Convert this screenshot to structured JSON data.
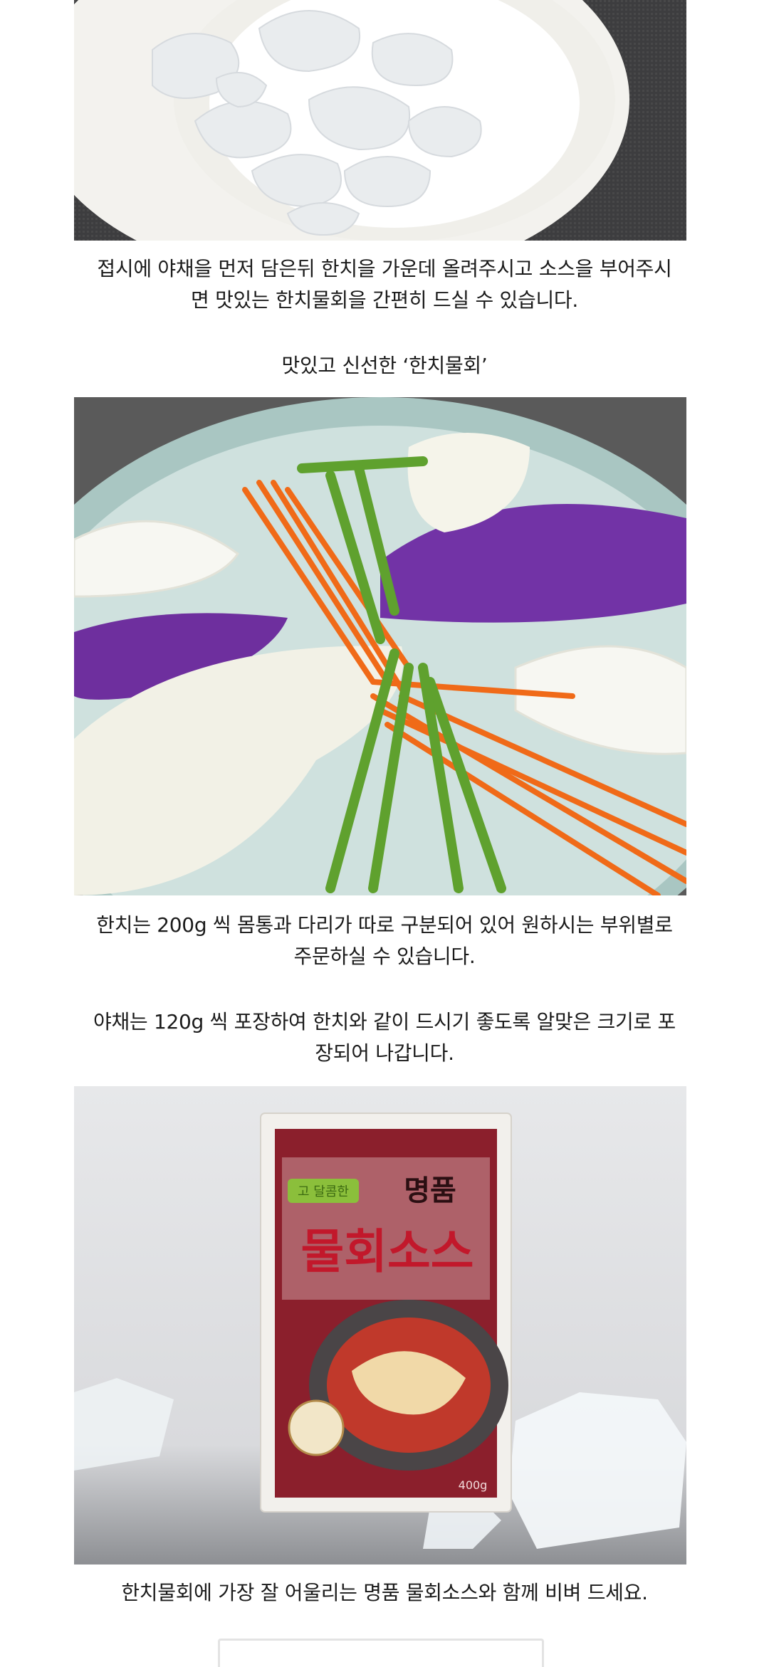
{
  "content": {
    "caption1": [
      "접시에 야채을 먼저 담은뒤 한치을 가운데 올려주시고 소스을 부어주시",
      "면 맛있는 한치물회을 간편히 드실 수 있습니다."
    ],
    "subtitle": "맛있고 신선한 ‘한치물회’",
    "caption2": [
      "한치는 200g 씩 몸통과 다리가 따로 구분되어 있어 원하시는 부위별로",
      "주문하실 수 있습니다."
    ],
    "caption3": [
      "야채는 120g 씩 포장하여 한치와 같이 드시기 좋도록 알맞은 크기로 포",
      "장되어 나갑니다."
    ],
    "caption4": "한치물회에 가장 잘 어울리는 명품 물회소스와 함께 비벼 드세요.",
    "sauce_package": {
      "tag": "고 달콤한",
      "brand": "명품",
      "name": "물회소스",
      "weight": "400g"
    }
  }
}
